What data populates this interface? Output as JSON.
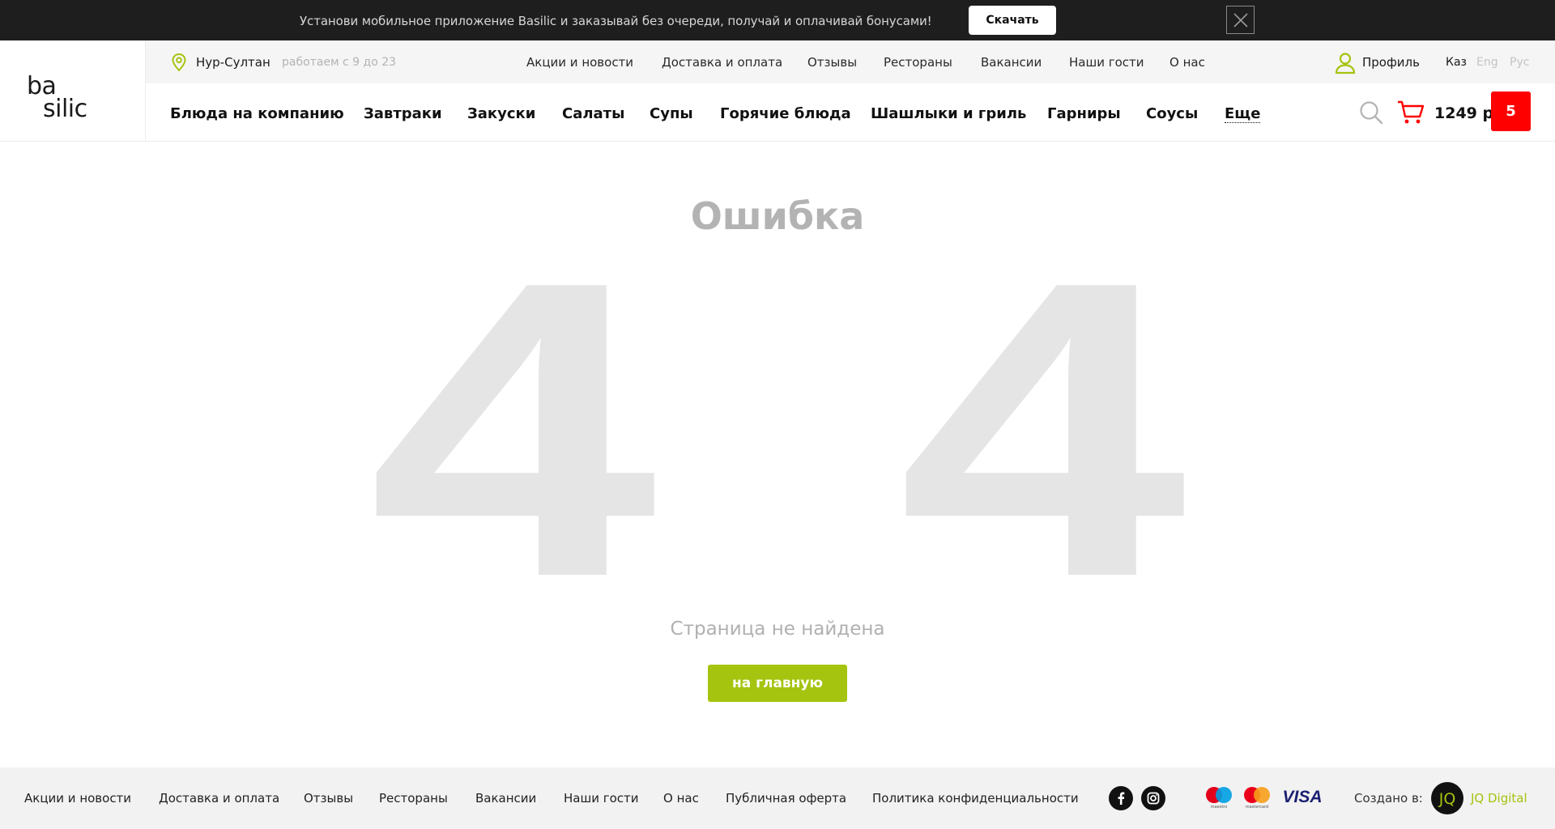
{
  "banner": {
    "text": "Установи мобильное приложение Basilic и заказывай без очереди, получай и оплачивай бонусами!",
    "download_label": "Скачать"
  },
  "logo": {
    "line1": "ba",
    "line2": "silic"
  },
  "subbar": {
    "city": "Нур-Султан",
    "hours": "работаем с 9 до 23",
    "links": [
      "Акции и новости",
      "Доставка и оплата",
      "Отзывы",
      "Рестораны",
      "Вакансии",
      "Наши гости",
      "О нас"
    ],
    "profile_label": "Профиль",
    "languages": [
      {
        "label": "Каз",
        "active": true
      },
      {
        "label": "Eng",
        "active": false
      },
      {
        "label": "Рус",
        "active": false
      }
    ]
  },
  "nav": {
    "items": [
      "Блюда на компанию",
      "Завтраки",
      "Закуски",
      "Салаты",
      "Супы",
      "Горячие блюда",
      "Шашлыки и гриль",
      "Гарниры",
      "Соусы"
    ],
    "more_label": "Еще"
  },
  "cart": {
    "total": "1249 р",
    "count": "5"
  },
  "error": {
    "title": "Ошибка",
    "code_digit_left": "4",
    "code_digit_right": "4",
    "message": "Страница не найдена",
    "home_label": "на главную"
  },
  "footer": {
    "links": [
      "Акции и новости",
      "Доставка и оплата",
      "Отзывы",
      "Рестораны",
      "Вакансии",
      "Наши гости",
      "О нас",
      "Публичная оферта",
      "Политика конфиденциальности"
    ],
    "social": [
      "facebook-icon",
      "instagram-icon"
    ],
    "payments": [
      "maestro",
      "mastercard",
      "VISA"
    ],
    "made_by_label": "Создано в:",
    "agency": "JQ Digital",
    "agency_logo": "JQ"
  },
  "colors": {
    "accent": "#a4c40f",
    "cart_badge": "#ff0000",
    "banner_bg": "#1e1e1e",
    "digits": "#e5e5e5"
  }
}
